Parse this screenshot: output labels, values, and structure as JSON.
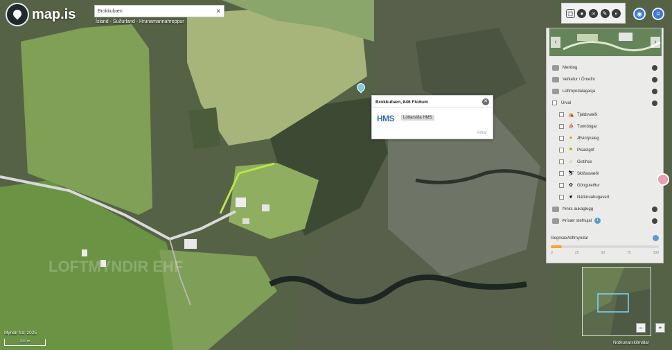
{
  "app": {
    "name": "map.is"
  },
  "search": {
    "value": "Brokkubæn"
  },
  "breadcrumb": "Ísland - Suðurland - Hrunamannahreppur",
  "popup": {
    "title": "Brokkubæn, 846 Flúðum",
    "brand": "HMS",
    "link": "Lóðarsíða HMS",
    "footer": "Aðrar"
  },
  "toolbar": {
    "icons": [
      "layers-icon",
      "pin-icon",
      "binoculars-icon",
      "pencil-icon",
      "globe-icon"
    ]
  },
  "layers_panel": {
    "items": [
      {
        "label": "Merking"
      },
      {
        "label": "Vefkefur / Örnefni"
      },
      {
        "label": "Loftmyndalagasja"
      },
      {
        "label": "Úrval"
      }
    ],
    "sub_items": [
      {
        "label": "Tjaldsvæði",
        "icon": "tent-icon"
      },
      {
        "label": "Tunnbúgar",
        "icon": "boat-icon"
      },
      {
        "label": "Ævintýraleg",
        "icon": "star-icon"
      },
      {
        "label": "Pisastgrif",
        "icon": "flag-icon"
      },
      {
        "label": "Gistihús",
        "icon": "house-icon"
      },
      {
        "label": "Skíðasvæði",
        "icon": "ski-icon"
      },
      {
        "label": "Gönguleiður",
        "icon": "hiker-icon"
      },
      {
        "label": "Náttúruáhugavert",
        "icon": "leaf-icon"
      }
    ],
    "extra_items": [
      {
        "label": "Þinks aukaglugg"
      },
      {
        "label": "Þrísær stefnujal"
      }
    ],
    "opacity": {
      "label": "Gegnsæi/loftmyndar",
      "ticks": [
        "0",
        "25",
        "50",
        "75",
        "100"
      ],
      "value": 0.1
    }
  },
  "minimap": {
    "label": "Notkunarskilmálar",
    "zoom_in": "+",
    "zoom_out": "−"
  },
  "credit": "Myndir frá: 2025",
  "scale": "100 m",
  "watermark": "LOFTMYNDIR EHF",
  "colors": {
    "road": "#d9d9d9",
    "parcel": "#b9e64a",
    "accent": "#3c78d8"
  }
}
